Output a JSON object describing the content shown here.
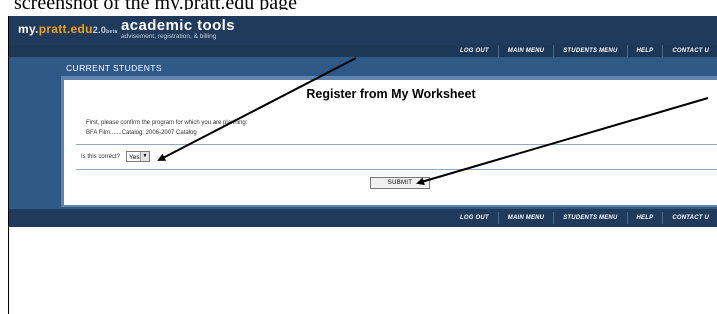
{
  "caption": "screenshot of the my.pratt.edu page",
  "brand": {
    "prefix": "my.",
    "domain": "pratt.edu",
    "version": "2.0",
    "tm": "beta"
  },
  "app": {
    "title": "academic tools",
    "subtitle": "advisement, registration, & billing"
  },
  "nav": {
    "items": [
      "LOG OUT",
      "MAIN MENU",
      "STUDENTS MENU",
      "HELP",
      "CONTACT U"
    ]
  },
  "section": {
    "title": "CURRENT STUDENTS"
  },
  "form": {
    "heading": "Register from My Worksheet",
    "intro": "First, please confirm the program for which you are planning:",
    "program": "BFA Film.......Catalog: 2006-2007 Catalog",
    "confirm_label": "Is this correct?",
    "confirm_value": "Yes",
    "submit_label": "SUBMIT"
  },
  "colors": {
    "header": "#1f3a5a",
    "accent": "#2e5886",
    "brand_orange": "#f2a20f",
    "annotation": "#000000"
  }
}
